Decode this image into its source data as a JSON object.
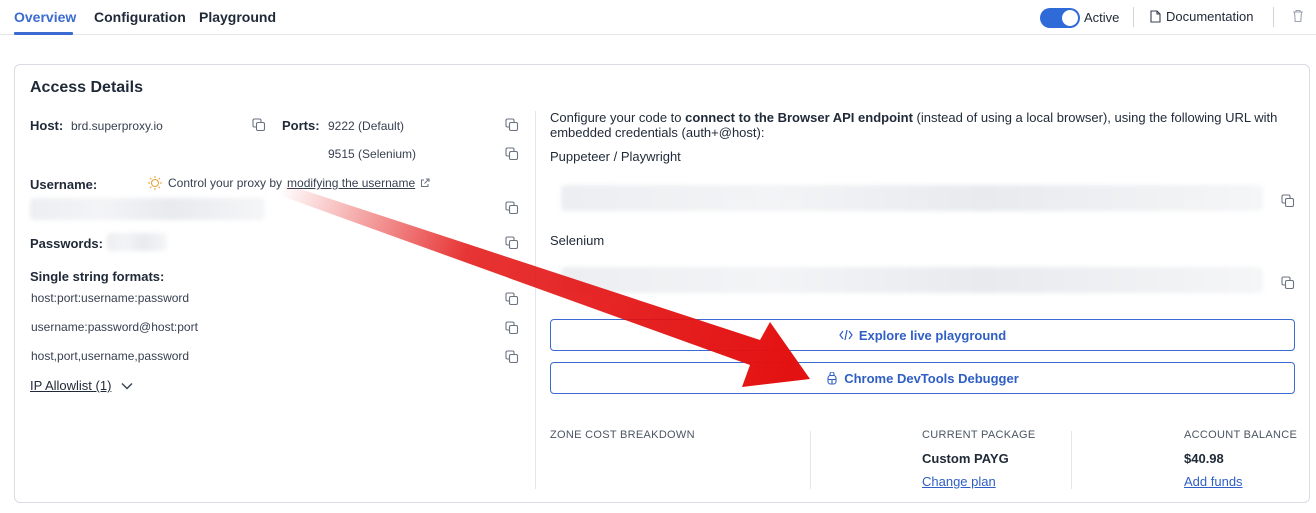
{
  "tabs": [
    {
      "label": "Overview",
      "active": true
    },
    {
      "label": "Configuration",
      "active": false
    },
    {
      "label": "Playground",
      "active": false
    }
  ],
  "header": {
    "status_label": "Active",
    "status_on": true,
    "documentation_label": "Documentation"
  },
  "access": {
    "title": "Access Details",
    "host_label": "Host:",
    "host_value": "brd.superproxy.io",
    "ports_label": "Ports:",
    "ports": [
      "9222 (Default)",
      "9515 (Selenium)"
    ],
    "username_label": "Username:",
    "username_hint_prefix": "Control your proxy by",
    "username_hint_link": "modifying the username",
    "passwords_label": "Passwords:",
    "formats_label": "Single string formats:",
    "formats": [
      "host:port:username:password",
      "username:password@host:port",
      "host,port,username,password"
    ],
    "allowlist_label": "IP Allowlist (1)"
  },
  "endpoint": {
    "intro_prefix": "Configure your code to",
    "intro_bold": "connect to the Browser API endpoint",
    "intro_suffix": "(instead of using a local browser), using the following URL with embedded credentials (auth+@host):",
    "puppeteer_label": "Puppeteer / Playwright",
    "selenium_label": "Selenium",
    "playground_button": "Explore live playground",
    "debugger_button": "Chrome DevTools Debugger"
  },
  "billing": {
    "zone_cost_label": "ZONE COST BREAKDOWN",
    "package_label": "CURRENT PACKAGE",
    "package_value": "Custom PAYG",
    "change_plan_link": "Change plan",
    "balance_label": "ACCOUNT BALANCE",
    "balance_value": "$40.98",
    "add_funds_link": "Add funds"
  },
  "colors": {
    "accent": "#3b6bd0",
    "toggle": "#2f6ad9",
    "annotation_arrow": "#e31010"
  },
  "icons": [
    "copy-icon",
    "bulb-icon",
    "external-link-icon",
    "document-icon",
    "trash-icon",
    "code-icon",
    "debugger-icon",
    "chevron-down-icon"
  ]
}
